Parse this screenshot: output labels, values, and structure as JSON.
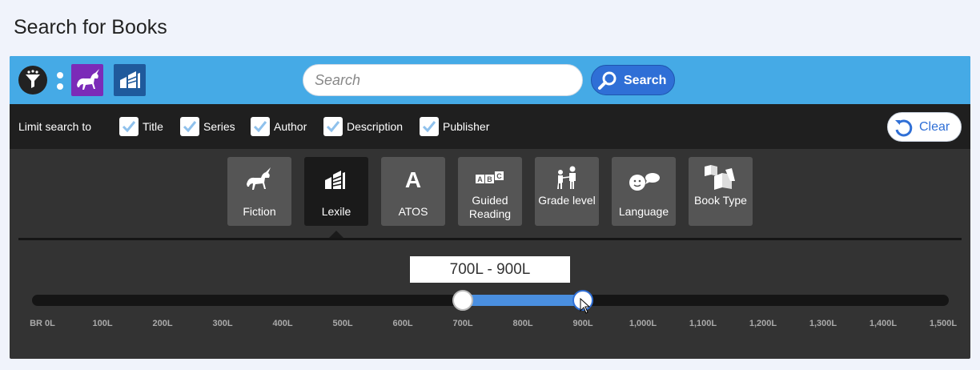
{
  "page": {
    "title": "Search for Books"
  },
  "toolbar": {
    "filter_icon": "funnel-icon",
    "chips": [
      {
        "name": "fiction",
        "icon": "unicorn-icon",
        "color": "#7b2bb8"
      },
      {
        "name": "lexile",
        "icon": "books-icon",
        "color": "#1f5a9c"
      }
    ],
    "search": {
      "placeholder": "Search",
      "value": ""
    },
    "search_button": "Search"
  },
  "limit": {
    "label": "Limit search to",
    "options": [
      {
        "label": "Title",
        "checked": true
      },
      {
        "label": "Series",
        "checked": true
      },
      {
        "label": "Author",
        "checked": true
      },
      {
        "label": "Description",
        "checked": true
      },
      {
        "label": "Publisher",
        "checked": true
      }
    ],
    "clear_button": "Clear"
  },
  "categories": [
    {
      "label": "Fiction",
      "icon": "unicorn-icon",
      "active": false
    },
    {
      "label": "Lexile",
      "icon": "books-icon",
      "active": true
    },
    {
      "label": "ATOS",
      "icon": "letter-a-icon",
      "active": false
    },
    {
      "label": "Guided Reading",
      "icon": "abc-blocks-icon",
      "active": false
    },
    {
      "label": "Grade level",
      "icon": "children-icon",
      "active": false
    },
    {
      "label": "Language",
      "icon": "speech-face-icon",
      "active": false
    },
    {
      "label": "Book Type",
      "icon": "open-books-icon",
      "active": false
    }
  ],
  "slider": {
    "display": "700L - 900L",
    "ticks": [
      "BR 0L",
      "100L",
      "200L",
      "300L",
      "400L",
      "500L",
      "600L",
      "700L",
      "800L",
      "900L",
      "1,000L",
      "1,100L",
      "1,200L",
      "1,300L",
      "1,400L",
      "1,500L"
    ],
    "min_index": 7,
    "max_index": 9,
    "accent_color": "#4a8fe0"
  }
}
